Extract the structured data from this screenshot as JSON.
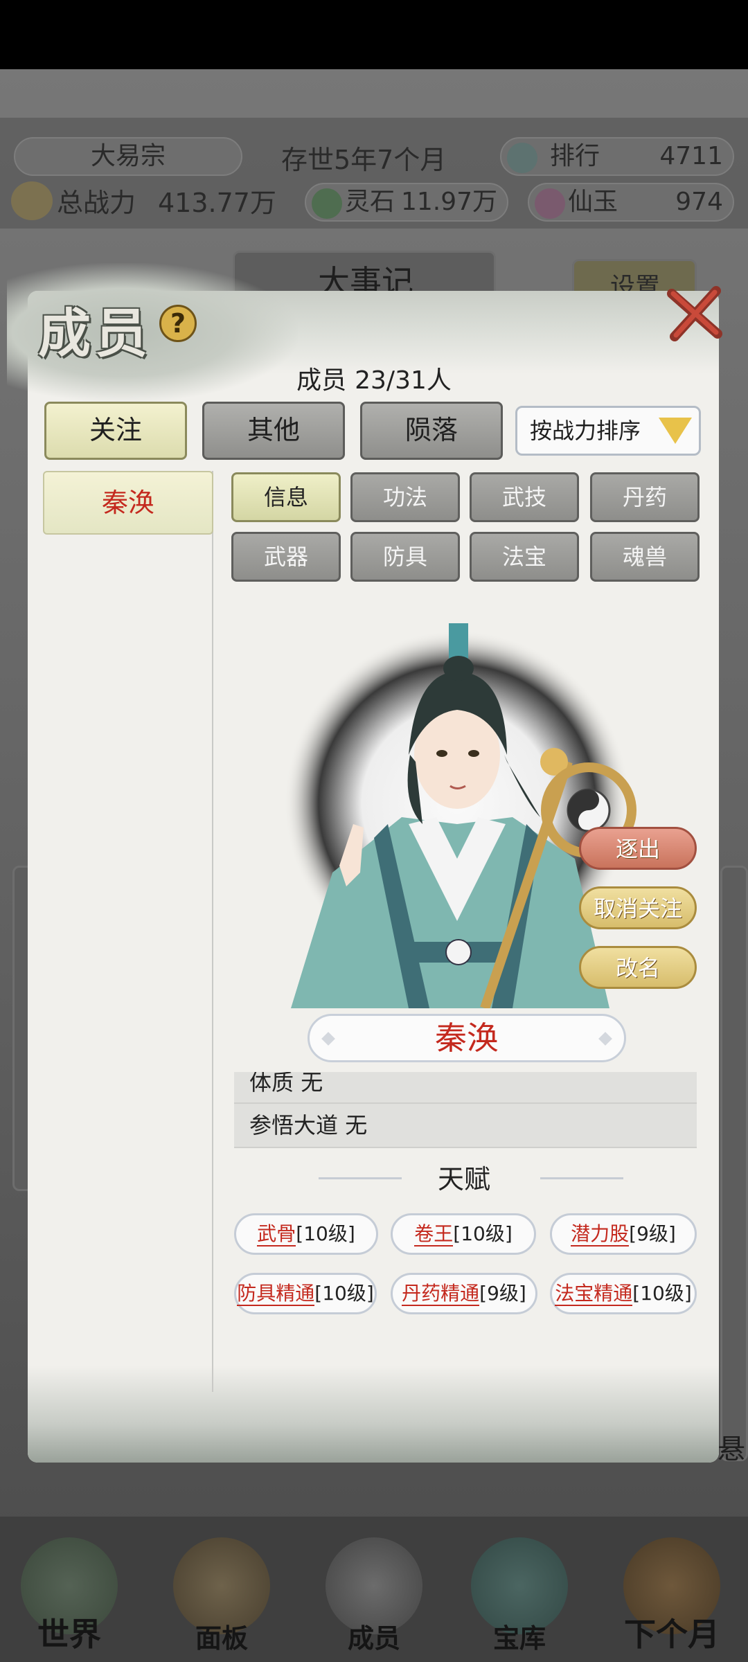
{
  "status_bar": {},
  "header": {
    "sect_name": "大易宗",
    "existence": "存世5年7个月",
    "rank_label": "排行",
    "rank_value": "4711",
    "power_label": "总战力",
    "power_value": "413.77万",
    "spirit_stone_label": "灵石",
    "spirit_stone_value": "11.97万",
    "jade_label": "仙玉",
    "jade_value": "974"
  },
  "background_labels": {
    "chronicle": "大事记",
    "settings": "设置",
    "side_hint": "悬"
  },
  "modal": {
    "title": "成员",
    "help": "?",
    "count_label": "成员",
    "count_value": "23/31人",
    "tabs": [
      "关注",
      "其他",
      "陨落"
    ],
    "sort_label": "按战力排序",
    "list": [
      "秦涣"
    ],
    "subtabs": [
      "信息",
      "功法",
      "武技",
      "丹药",
      "武器",
      "防具",
      "法宝",
      "魂兽"
    ],
    "actions": {
      "kick": "逐出",
      "unfollow": "取消关注",
      "rename": "改名"
    },
    "character_name": "秦涣",
    "info_rows": [
      {
        "label": "体质",
        "value": "无"
      },
      {
        "label": "参悟大道",
        "value": "无"
      }
    ],
    "talent_header": "天赋",
    "talents": [
      {
        "name": "武骨",
        "level": "[10级]"
      },
      {
        "name": "卷王",
        "level": "[10级]"
      },
      {
        "name": "潜力股",
        "level": "[9级]"
      },
      {
        "name": "防具精通",
        "level": "[10级]"
      },
      {
        "name": "丹药精通",
        "level": "[9级]"
      },
      {
        "name": "法宝精通",
        "level": "[10级]"
      }
    ]
  },
  "bottom_nav": [
    "世界",
    "面板",
    "成员",
    "宝库",
    "下个月"
  ],
  "colors": {
    "accent_red": "#c4291e",
    "active_tab": "#f3f1cf",
    "inactive_tab": "#9e9e9b"
  }
}
